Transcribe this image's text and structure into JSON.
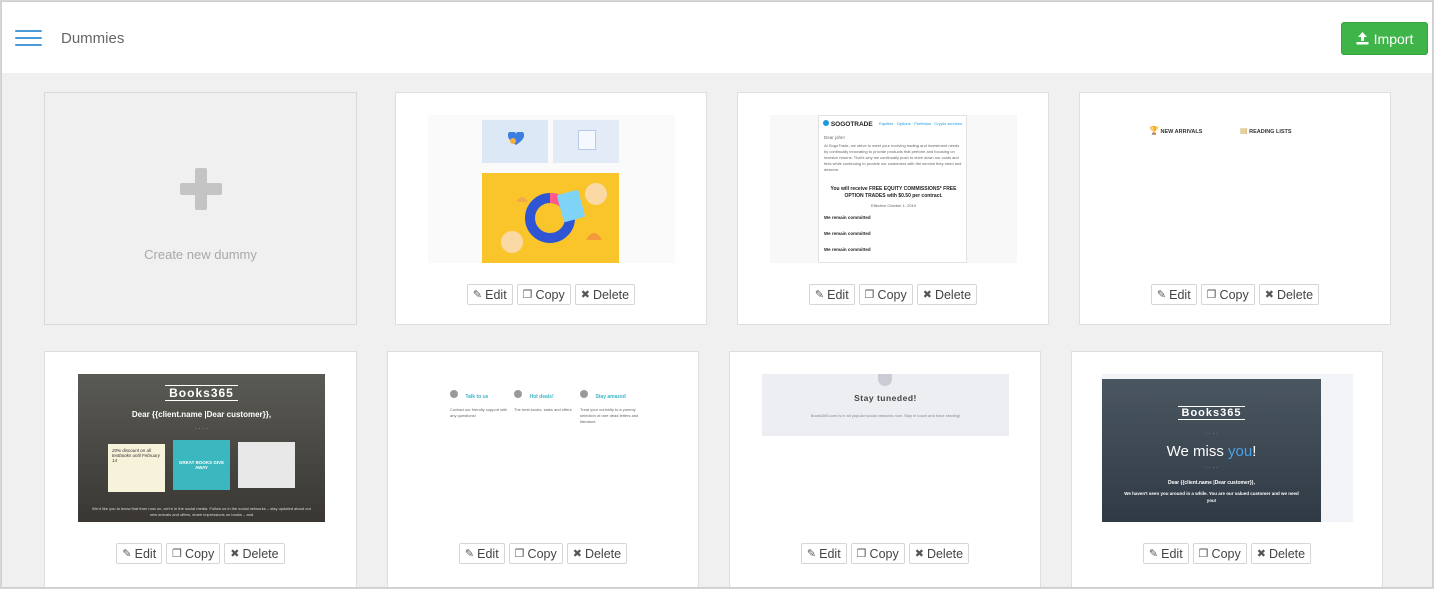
{
  "header": {
    "title": "Dummies",
    "import_label": "Import"
  },
  "new_dummy": {
    "label": "Create new dummy"
  },
  "actions": {
    "edit": "Edit",
    "copy": "Copy",
    "delete": "Delete"
  },
  "thumbs": {
    "sogotrade": {
      "brand": "SOGOTRADE",
      "nav": "Equities · Options · Portfolios · Crypto services",
      "greeting": "Dear john!",
      "intro": "At SogoTrade, we strive to meet your evolving trading and investment needs by continually innovating to provide products that perform and focusing on investor returns. That's why we continually push to drive down our costs and fees while continuing to provide our customers with the service they need and deserve.",
      "headline": "You will receive FREE EQUITY COMMISSIONS* FREE OPTION TRADES with $0.50 per contract.",
      "effective": "Effective October 1, 2019",
      "committed": "We remain committed"
    },
    "arrivals": {
      "new_arrivals": "NEW ARRIVALS",
      "reading_lists": "READING LISTS"
    },
    "books": {
      "brand": "Books365",
      "greeting": "Dear {{client.name |Dear customer}},",
      "promo": "20% discount on all textbooks until February 14",
      "promo2": "GREAT BOOKS GIVE AWAY",
      "footer": "We'd like you to know that from now on, we're in the social media. Follow us in the social networks – stay updated about our new arrivals and offers, share impressions on books – and"
    },
    "contact": {
      "c1_title": "Talk to us",
      "c1_text": "Contact our friendly support with any questions!",
      "c2_title": "Hot deals!",
      "c2_text": "The best books, sales and offers",
      "c3_title": "Stay amazed",
      "c3_text": "Treat your curiosity to a yummy selection of rare dead letters and literature"
    },
    "tuned": {
      "title": "Stay tuneded!",
      "text": "Books365.com is in all popular social networks now. Stay in touch and have reading!"
    },
    "miss": {
      "brand": "Books365",
      "headline_a": "We miss ",
      "headline_b": "you",
      "headline_c": "!",
      "greeting": "Dear {{client.name |Dear customer}},",
      "text": "We haven't seen you around in a while. You are our valued customer and we need you!"
    }
  }
}
